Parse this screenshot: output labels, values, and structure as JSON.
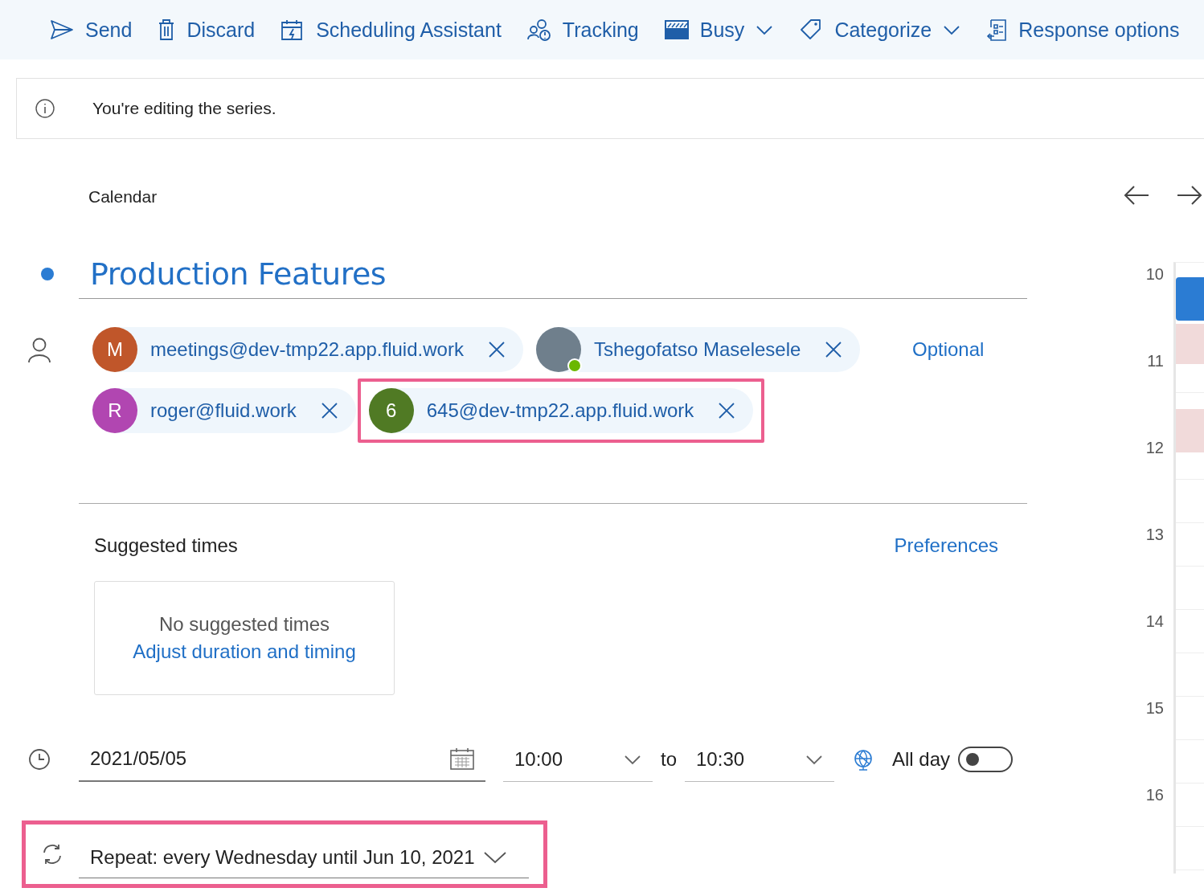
{
  "toolbar": {
    "items": [
      {
        "label": "Send",
        "dropdown": false
      },
      {
        "label": "Discard",
        "dropdown": false
      },
      {
        "label": "Scheduling Assistant",
        "dropdown": false
      },
      {
        "label": "Tracking",
        "dropdown": false
      },
      {
        "label": "Busy",
        "dropdown": true
      },
      {
        "label": "Categorize",
        "dropdown": true
      },
      {
        "label": "Response options",
        "dropdown": false
      }
    ]
  },
  "info_bar": {
    "message": "You're editing the series."
  },
  "calendar_label": "Calendar",
  "title": "Production Features",
  "attendees": [
    {
      "kind": "initials",
      "initial": "M",
      "name": "meetings@dev-tmp22.app.fluid.work",
      "color": "#c0562a",
      "highlighted": false
    },
    {
      "kind": "photo",
      "name": "Tshegofatso Maselesele",
      "online": true,
      "highlighted": false
    },
    {
      "kind": "initials",
      "initial": "R",
      "name": "roger@fluid.work",
      "color": "#b146b1",
      "highlighted": false
    },
    {
      "kind": "initials",
      "initial": "6",
      "name": "645@dev-tmp22.app.fluid.work",
      "color": "#507a24",
      "highlighted": true
    }
  ],
  "optional_link": "Optional",
  "suggested_times": {
    "heading": "Suggested times",
    "preferences": "Preferences",
    "empty_message": "No suggested times",
    "adjust_link": "Adjust duration and timing"
  },
  "date": "2021/05/05",
  "start_time": "10:00",
  "separator": "to",
  "end_time": "10:30",
  "all_day": {
    "label": "All day",
    "on": false
  },
  "repeat": {
    "label": "Repeat:",
    "value": "every Wednesday until Jun 10, 2021",
    "highlighted": true
  },
  "timeline": {
    "hours": [
      "10",
      "11",
      "12",
      "13",
      "14",
      "15",
      "16"
    ]
  }
}
